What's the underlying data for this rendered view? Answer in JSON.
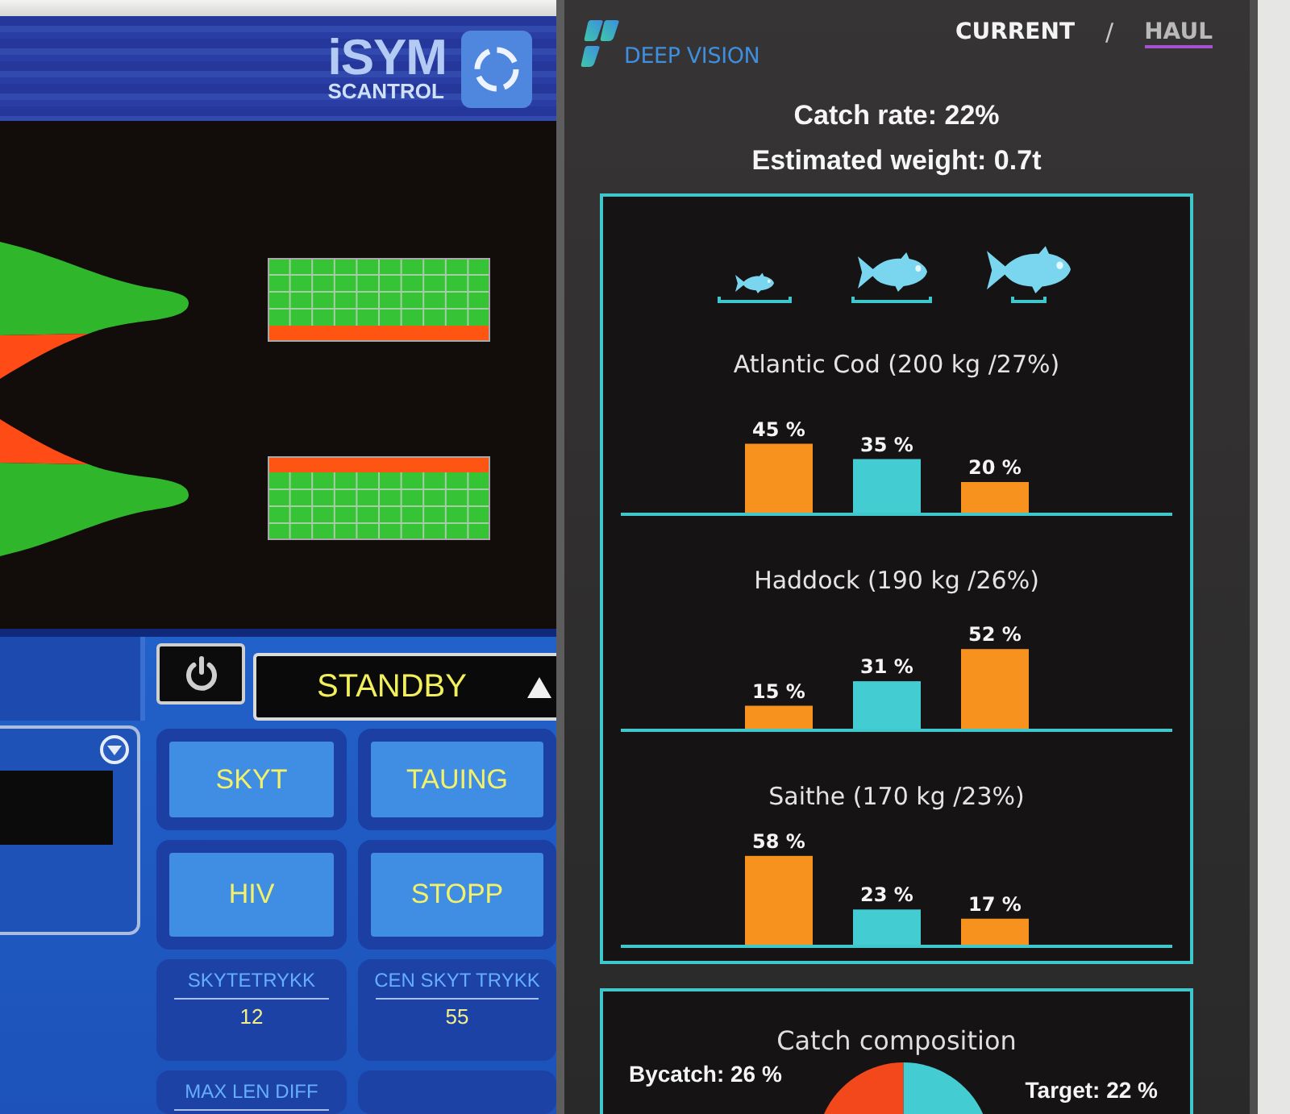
{
  "isym_screen": {
    "logo": {
      "title": "iSYM",
      "subtitle": "SCANTROL"
    },
    "mode": "STANDBY",
    "buttons": [
      "SKYT",
      "TAUING",
      "HIV",
      "STOPP"
    ],
    "readouts": [
      {
        "label": "SKYTETRYKK",
        "value": "12"
      },
      {
        "label": "CEN SKYT TRYKK",
        "value": "55"
      },
      {
        "label": "MAX LEN DIFF"
      }
    ]
  },
  "deep_vision_screen": {
    "logo": "DEEP VISION",
    "tabs": [
      {
        "label": "CURRENT",
        "selected": true
      },
      {
        "label": "HAUL",
        "selected": false
      }
    ],
    "tab_separator": "/",
    "catch_rate": "Catch rate: 22%",
    "estimated_weight": "Estimated weight: 0.7t",
    "species": [
      {
        "chart_data": {
          "type": "bar",
          "title": "Atlantic Cod (200 kg /27%)",
          "values": [
            45,
            35,
            20
          ],
          "colors": [
            "#f7921e",
            "#44ccd3",
            "#f7921e"
          ],
          "value_labels": [
            "45 %",
            "35 %",
            "20 %"
          ]
        }
      },
      {
        "chart_data": {
          "type": "bar",
          "title": "Haddock (190 kg /26%)",
          "values": [
            15,
            31,
            52
          ],
          "colors": [
            "#f7921e",
            "#44ccd3",
            "#f7921e"
          ],
          "value_labels": [
            "15 %",
            "31 %",
            "52 %"
          ]
        }
      },
      {
        "chart_data": {
          "type": "bar",
          "title": "Saithe (170 kg /23%)",
          "values": [
            58,
            23,
            17
          ],
          "colors": [
            "#f7921e",
            "#44ccd3",
            "#f7921e"
          ],
          "value_labels": [
            "58 %",
            "23 %",
            "17 %"
          ]
        }
      }
    ],
    "composition": {
      "title": "Catch composition",
      "slices": [
        {
          "label": "Bycatch: 26 %",
          "color": "#f2481c"
        },
        {
          "label": "Target: 22 %",
          "color": "#44ccd3"
        }
      ]
    }
  }
}
